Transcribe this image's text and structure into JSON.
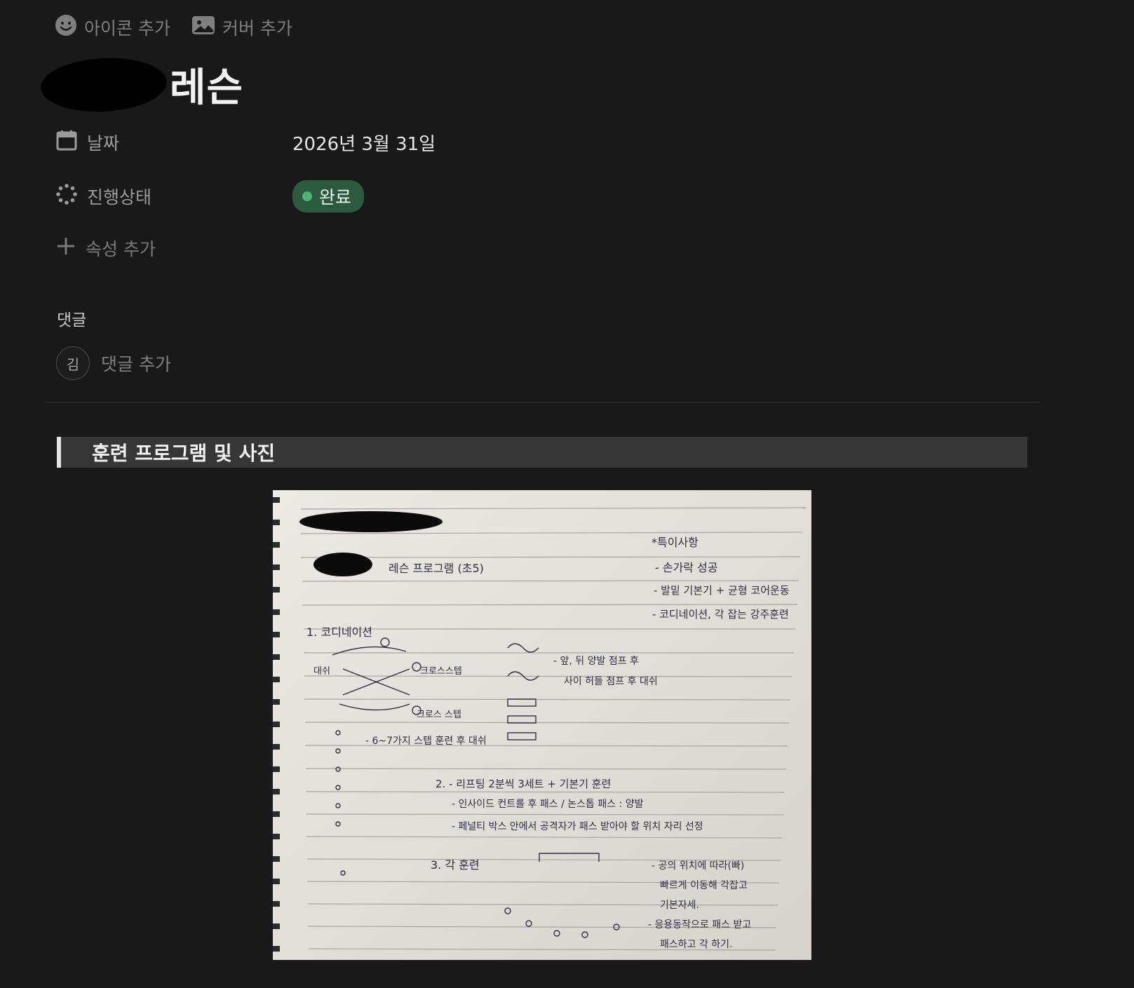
{
  "top_actions": {
    "add_icon_label": "아이콘 추가",
    "add_cover_label": "커버 추가"
  },
  "page": {
    "title": "레슨"
  },
  "properties": {
    "date": {
      "label": "날짜",
      "value": "2026년 3월 31일",
      "icon": "calendar-icon"
    },
    "status": {
      "label": "진행상태",
      "value": "완료",
      "icon": "status-loader-icon",
      "color": "#2b5a3f"
    },
    "add_property_label": "속성 추가"
  },
  "comments": {
    "title": "댓글",
    "avatar_initial": "김",
    "placeholder": "댓글 추가"
  },
  "callout": {
    "text": "훈련 프로그램 및 사진"
  },
  "photo": {
    "notes_header": "*특이사항",
    "notes": [
      "- 손가락 성공",
      "- 발밑 기본기 + 균형 코어운동",
      "- 코디네이션, 각 잡는 강주훈련"
    ],
    "program_title": "레슨 프로그램 (초5)",
    "section1": "1. 코디네이션",
    "labels": {
      "dash": "대쉬",
      "cross_step": "크로스스텝",
      "cross_step2": "크로스 스텝",
      "jump_note": "- 앞, 뒤 양발 점프 후",
      "hurdle_note": "사이 허들 점프 후 대쉬",
      "step_note": "- 6~7가지 스텝 훈련 후 대쉬"
    },
    "section2": "2. - 리프팅 2분씩 3세트 + 기본기 훈련",
    "section2_a": "- 인사이드 컨트롤 후 패스 / 논스톱 패스 : 양발",
    "section2_b": "- 페널티 박스 안에서 공격자가 패스 받아야 할 위치 자리 선정",
    "section3": "3. 각 훈련",
    "section3_a": "- 공의 위치에 따라(빠)",
    "section3_b": "빠르게 이동해 각잡고",
    "section3_c": "기본자세.",
    "section3_d": "- 응용동작으로 패스 받고",
    "section3_e": "패스하고 각 하기."
  }
}
